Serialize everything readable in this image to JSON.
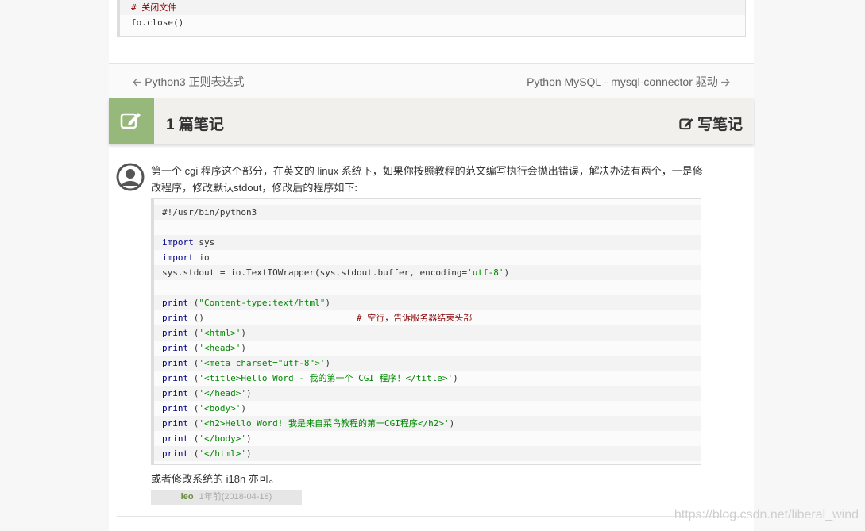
{
  "top_code": {
    "lines": [
      {
        "text": "# 关闭文件",
        "type": "comment"
      },
      {
        "text": "fo.close()",
        "type": "code"
      }
    ]
  },
  "nav": {
    "prev_label": "Python3 正则表达式",
    "next_label": "Python MySQL - mysql-connector 驱动"
  },
  "notes": {
    "count_label": "1 篇笔记",
    "write_label": "写笔记",
    "accent_color": "#96b97b"
  },
  "note": {
    "text": "第一个 cgi 程序这个部分，在英文的 linux 系统下，如果你按照教程的范文编写执行会抛出错误，解决办法有两个，一是修改程序，修改默认stdout，修改后的程序如下:",
    "code_lines": [
      {
        "kw": "",
        "rest": "#!/usr/bin/python3"
      },
      {
        "kw": "",
        "rest": ""
      },
      {
        "kw": "import",
        "rest": " sys"
      },
      {
        "kw": "import",
        "rest": " io"
      },
      {
        "kw": "",
        "rest": "sys.stdout = io.TextIOWrapper(sys.stdout.buffer, encoding=",
        "str": "'utf-8'",
        "tail": ")"
      },
      {
        "kw": "",
        "rest": ""
      },
      {
        "kw": "print",
        "rest": " (",
        "str": "\"Content-type:text/html\"",
        "tail": ")"
      },
      {
        "kw": "print",
        "rest": " ()                             ",
        "cmt": "# 空行，告诉服务器结束头部"
      },
      {
        "kw": "print",
        "rest": " (",
        "str": "'<html>'",
        "tail": ")"
      },
      {
        "kw": "print",
        "rest": " (",
        "str": "'<head>'",
        "tail": ")"
      },
      {
        "kw": "print",
        "rest": " (",
        "str": "'<meta charset=\"utf-8\">'",
        "tail": ")"
      },
      {
        "kw": "print",
        "rest": " (",
        "str": "'<title>Hello Word - 我的第一个 CGI 程序！</title>'",
        "tail": ")"
      },
      {
        "kw": "print",
        "rest": " (",
        "str": "'</head>'",
        "tail": ")"
      },
      {
        "kw": "print",
        "rest": " (",
        "str": "'<body>'",
        "tail": ")"
      },
      {
        "kw": "print",
        "rest": " (",
        "str": "'<h2>Hello Word! 我是来自菜鸟教程的第一CGI程序</h2>'",
        "tail": ")"
      },
      {
        "kw": "print",
        "rest": " (",
        "str": "'</body>'",
        "tail": ")"
      },
      {
        "kw": "print",
        "rest": " (",
        "str": "'</html>'",
        "tail": ")"
      }
    ],
    "after_text": "或者修改系统的 i18n 亦可。",
    "author": "leo",
    "time_ago": "1年前",
    "date": "(2018-04-18)"
  },
  "watermark": "https://blog.csdn.net/liberal_wind",
  "icons": {
    "notes_icon": "edit-icon",
    "write_icon": "edit-icon",
    "prev_icon": "arrow-left-icon",
    "next_icon": "arrow-right-icon",
    "avatar_icon": "user-avatar-icon"
  }
}
